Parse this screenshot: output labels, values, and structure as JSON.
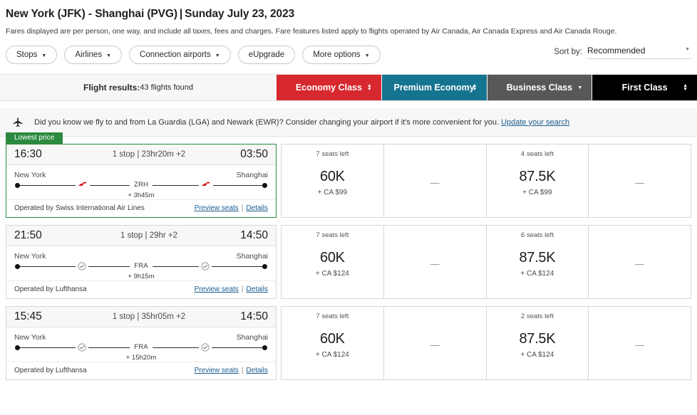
{
  "header": {
    "route": "New York (JFK) - Shanghai (PVG)",
    "separator": "|",
    "date": "Sunday July 23, 2023",
    "fare_note": "Fares displayed are per person, one way, and include all taxes, fees and charges. Fare features listed apply to flights operated by Air Canada, Air Canada Express and Air Canada Rouge."
  },
  "filters": {
    "pills": [
      {
        "label": "Stops",
        "has_caret": true
      },
      {
        "label": "Airlines",
        "has_caret": true
      },
      {
        "label": "Connection airports",
        "has_caret": true
      },
      {
        "label": "eUpgrade",
        "has_caret": false
      },
      {
        "label": "More options",
        "has_caret": true
      }
    ],
    "sort_label": "Sort by:",
    "sort_value": "Recommended"
  },
  "results_strip": {
    "results_label": "Flight results:",
    "results_count": "43 flights found",
    "cabins": [
      {
        "label": "Economy Class",
        "color": "#d8282f",
        "sorter": "updown"
      },
      {
        "label": "Premium Economy",
        "color": "#15748f",
        "sorter": "updown"
      },
      {
        "label": "Business Class",
        "color": "#585858",
        "sorter": "down"
      },
      {
        "label": "First Class",
        "color": "#000000",
        "sorter": "updown"
      }
    ]
  },
  "notice": {
    "text": "Did you know we fly to and from La Guardia (LGA) and Newark (EWR)? Consider changing your airport if it's more convenient for you.",
    "link": "Update your search"
  },
  "flights": [
    {
      "badge": "Lowest price",
      "highlight": true,
      "depart_time": "16:30",
      "arrive_time": "03:50",
      "stops": "1 stop  |  23hr20m +2",
      "origin": "New York",
      "destination": "Shanghai",
      "connection": "ZRH",
      "layover": "+ 3h45m",
      "operated_by": "Operated by Swiss International Air Lines",
      "preview_seats": "Preview seats",
      "details": "Details",
      "carrier_logo": "swiss-logo",
      "fares": [
        {
          "seats": "7 seats left",
          "miles": "60K",
          "cash": "+ CA $99",
          "available": true
        },
        {
          "seats": "",
          "miles": "",
          "cash": "",
          "available": false
        },
        {
          "seats": "4 seats left",
          "miles": "87.5K",
          "cash": "+ CA $99",
          "available": true
        },
        {
          "seats": "",
          "miles": "",
          "cash": "",
          "available": false
        }
      ]
    },
    {
      "badge": "",
      "highlight": false,
      "depart_time": "21:50",
      "arrive_time": "14:50",
      "stops": "1 stop  |  29hr +2",
      "origin": "New York",
      "destination": "Shanghai",
      "connection": "FRA",
      "layover": "+ 9h15m",
      "operated_by": "Operated by Lufthansa",
      "preview_seats": "Preview seats",
      "details": "Details",
      "carrier_logo": "lufthansa-logo",
      "fares": [
        {
          "seats": "7 seats left",
          "miles": "60K",
          "cash": "+ CA $124",
          "available": true
        },
        {
          "seats": "",
          "miles": "",
          "cash": "",
          "available": false
        },
        {
          "seats": "6 seats left",
          "miles": "87.5K",
          "cash": "+ CA $124",
          "available": true
        },
        {
          "seats": "",
          "miles": "",
          "cash": "",
          "available": false
        }
      ]
    },
    {
      "badge": "",
      "highlight": false,
      "depart_time": "15:45",
      "arrive_time": "14:50",
      "stops": "1 stop  |  35hr05m +2",
      "origin": "New York",
      "destination": "Shanghai",
      "connection": "FRA",
      "layover": "+ 15h20m",
      "operated_by": "Operated by Lufthansa",
      "preview_seats": "Preview seats",
      "details": "Details",
      "carrier_logo": "lufthansa-logo",
      "fares": [
        {
          "seats": "7 seats left",
          "miles": "60K",
          "cash": "+ CA $124",
          "available": true
        },
        {
          "seats": "",
          "miles": "",
          "cash": "",
          "available": false
        },
        {
          "seats": "2 seats left",
          "miles": "87.5K",
          "cash": "+ CA $124",
          "available": true
        },
        {
          "seats": "",
          "miles": "",
          "cash": "",
          "available": false
        }
      ]
    }
  ],
  "colors": {
    "lowest_price_green": "#2c8a3f",
    "link_blue": "#1a5c8f",
    "swiss_red": "#d40e14"
  }
}
